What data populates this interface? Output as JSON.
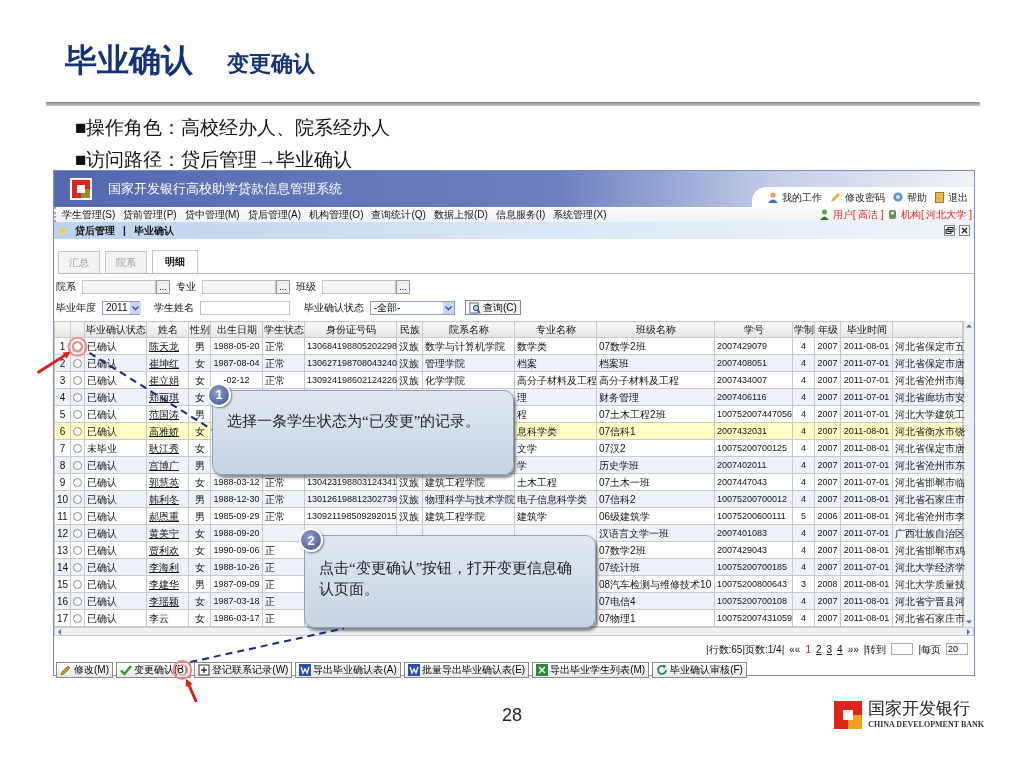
{
  "slide": {
    "title": "毕业确认",
    "subtitle": "变更确认",
    "bullets": [
      {
        "marker": "■",
        "text": "操作角色：高校经办人、院系经办人"
      },
      {
        "marker": "■",
        "text": "访问路径：贷后管理→毕业确认"
      }
    ],
    "page_number": "28",
    "footer_logo": {
      "name": "国家开发银行",
      "english": "CHINA DEVELOPMENT BANK"
    }
  },
  "app": {
    "title": "国家开发银行高校助学贷款信息管理系统",
    "top_links": [
      {
        "label": "我的工作",
        "kind": "user"
      },
      {
        "label": "修改密码",
        "kind": "pencil"
      },
      {
        "label": "帮助",
        "kind": "help"
      },
      {
        "label": "退出",
        "kind": "door"
      }
    ],
    "menu": [
      "学生管理(S)",
      "贷前管理(P)",
      "贷中管理(M)",
      "贷后管理(A)",
      "机构管理(O)",
      "查询统计(Q)",
      "数据上报(D)",
      "信息服务(I)",
      "系统管理(X)"
    ],
    "user": "用户[ 高洁 ]",
    "org": "机构[ 河北大学 ]",
    "breadcrumb": [
      "贷后管理",
      "|",
      "毕业确认"
    ],
    "tabs": [
      {
        "label": "汇总",
        "selected": false
      },
      {
        "label": "院系",
        "selected": false
      },
      {
        "label": "明细",
        "selected": true
      }
    ],
    "filters": [
      {
        "label": "院系",
        "button": "..."
      },
      {
        "label": "专业",
        "button": "..."
      },
      {
        "label": "班级",
        "button": "..."
      }
    ],
    "year": {
      "label": "毕业年度",
      "value": "2011"
    },
    "name_field": {
      "label": "学生姓名"
    },
    "status_filter": {
      "label": "毕业确认状态",
      "value": "-全部-"
    },
    "query_button": "查询(C)",
    "table": {
      "columns": [
        "毕业确认状态",
        "姓名",
        "性别",
        "出生日期",
        "学生状态",
        "身份证号码",
        "民族",
        "院系名称",
        "专业名称",
        "班级名称",
        "学号",
        "学制",
        "年级",
        "毕业时间"
      ],
      "rows": [
        {
          "number": "1",
          "selected": false,
          "highlighted": false,
          "linked": true,
          "cells": [
            "已确认",
            "陈天龙",
            "男",
            "1988-05-20",
            "正常",
            "130684198805202298",
            "汉族",
            "数学与计算机学院",
            "数学类",
            "07数学2班",
            "2007429079",
            "4",
            "2007",
            "2011-08-01",
            "河北省保定市五"
          ]
        },
        {
          "number": "2",
          "selected": false,
          "highlighted": false,
          "linked": true,
          "cells": [
            "已确认",
            "崔坤红",
            "女",
            "1987-08-04",
            "正常",
            "130627198708043240",
            "汉族",
            "管理学院",
            "档案",
            "档案班",
            "2007408051",
            "4",
            "2007",
            "2011-07-01",
            "河北省保定市唐"
          ]
        },
        {
          "number": "3",
          "selected": false,
          "highlighted": false,
          "linked": true,
          "cells": [
            "已确认",
            "崔立娟",
            "女",
            "-02-12",
            "正常",
            "130924198602124226",
            "汉族",
            "化学学院",
            "高分子材料及工程",
            "高分子材料及工程",
            "2007434007",
            "4",
            "2007",
            "2011-07-01",
            "河北省沧州市海"
          ]
        },
        {
          "number": "4",
          "selected": false,
          "highlighted": false,
          "linked": true,
          "cells": [
            "已确认",
            "郑丽琪",
            "女",
            null,
            null,
            null,
            null,
            null,
            "理",
            "财务管理",
            "2007406116",
            "4",
            "2007",
            "2011-07-01",
            "河北省廊坊市安"
          ]
        },
        {
          "number": "5",
          "selected": false,
          "highlighted": false,
          "linked": true,
          "cells": [
            "已确认",
            "范国涛",
            "男",
            null,
            null,
            null,
            null,
            null,
            "程",
            "07土木工程2班",
            "100752007447056",
            "4",
            "2007",
            "2011-07-01",
            "河北大学建筑工"
          ]
        },
        {
          "number": "6",
          "selected": false,
          "highlighted": true,
          "linked": true,
          "cells": [
            "已确认",
            "高雅娇",
            "女",
            null,
            null,
            null,
            null,
            null,
            "息科学类",
            "07信科1",
            "2007432031",
            "4",
            "2007",
            "2011-08-01",
            "河北省衡水市饶"
          ]
        },
        {
          "number": "7",
          "selected": false,
          "highlighted": false,
          "linked": true,
          "cells": [
            "未毕业",
            "耿江秀",
            "女",
            null,
            null,
            null,
            null,
            null,
            "文学",
            "07汉2",
            "10075200700125",
            "4",
            "2007",
            "2011-08-01",
            "河北省保定市唐"
          ]
        },
        {
          "number": "8",
          "selected": false,
          "highlighted": false,
          "linked": true,
          "cells": [
            "已确认",
            "宫博广",
            "男",
            null,
            null,
            null,
            null,
            null,
            "学",
            "历史学班",
            "2007402011",
            "4",
            "2007",
            "2011-07-01",
            "河北省沧州市东"
          ]
        },
        {
          "number": "9",
          "selected": false,
          "highlighted": false,
          "linked": true,
          "cells": [
            "已确认",
            "郭慧英",
            "女",
            "1988-03-12",
            "正常",
            "130423198803124341",
            "汉族",
            "建筑工程学院",
            "土木工程",
            "07土木一班",
            "2007447043",
            "4",
            "2007",
            "2011-07-01",
            "河北省邯郸市临"
          ]
        },
        {
          "number": "10",
          "selected": false,
          "highlighted": false,
          "linked": true,
          "cells": [
            "已确认",
            "韩利冬",
            "男",
            "1988-12-30",
            "正常",
            "130126198812302739",
            "汉族",
            "物理科学与技术学院",
            "电子信息科学类",
            "07信科2",
            "10075200700012",
            "4",
            "2007",
            "2011-08-01",
            "河北省石家庄市"
          ]
        },
        {
          "number": "11",
          "selected": false,
          "highlighted": false,
          "linked": true,
          "cells": [
            "已确认",
            "郝恩重",
            "男",
            "1985-09-29",
            "正常",
            "130921198509292015",
            "汉族",
            "建筑工程学院",
            "建筑学",
            "06级建筑学",
            "10075200600111",
            "5",
            "2006",
            "2011-08-01",
            "河北省沧州市李"
          ]
        },
        {
          "number": "12",
          "selected": false,
          "highlighted": false,
          "linked": true,
          "cells": [
            "已确认",
            "黄美宁",
            "女",
            "1988-09-20",
            null,
            null,
            null,
            null,
            null,
            "汉语言文学一班",
            "2007401083",
            "4",
            "2007",
            "2011-07-01",
            "广西壮族自治区"
          ]
        },
        {
          "number": "13",
          "selected": false,
          "highlighted": false,
          "linked": true,
          "cells": [
            "已确认",
            "贾利欢",
            "女",
            "1990-09-06",
            "正",
            null,
            null,
            null,
            null,
            "07数学2班",
            "2007429043",
            "4",
            "2007",
            "2011-08-01",
            "河北省邯郸市鸡"
          ]
        },
        {
          "number": "14",
          "selected": false,
          "highlighted": false,
          "linked": true,
          "cells": [
            "已确认",
            "李海利",
            "女",
            "1988-10-26",
            "正",
            null,
            null,
            null,
            null,
            "07统计班",
            "10075200700185",
            "4",
            "2007",
            "2011-07-01",
            "河北大学经济学"
          ]
        },
        {
          "number": "15",
          "selected": false,
          "highlighted": false,
          "linked": true,
          "cells": [
            "已确认",
            "李建华",
            "男",
            "1987-09-09",
            "正",
            null,
            null,
            null,
            null,
            "08汽车检测与维修技术10",
            "10075200800643",
            "3",
            "2008",
            "2011-08-01",
            "河北大学质量技"
          ]
        },
        {
          "number": "16",
          "selected": false,
          "highlighted": false,
          "linked": true,
          "cells": [
            "已确认",
            "李瑶颖",
            "女",
            "1987-03-18",
            "正",
            null,
            null,
            null,
            null,
            "07电信4",
            "10075200700108",
            "4",
            "2007",
            "2011-08-01",
            "河北省宁晋县河"
          ]
        },
        {
          "number": "17",
          "selected": false,
          "highlighted": false,
          "linked": false,
          "cells": [
            "已确认",
            "李云",
            "女",
            "1986-03-17",
            "正",
            null,
            null,
            null,
            null,
            "07物理1",
            "100752007431059",
            "4",
            "2007",
            "2011-08-01",
            "河北省石家庄市"
          ]
        }
      ]
    },
    "pager": {
      "summary": "|行数:65|页数:1/4|",
      "first": "««",
      "pages": [
        {
          "label": "1",
          "selected": true
        },
        {
          "label": "2",
          "selected": false
        },
        {
          "label": "3",
          "selected": false
        },
        {
          "label": "4",
          "selected": false
        }
      ],
      "last": "»»",
      "goto": "|转到",
      "per_page_label": "|每页",
      "per_page": "20"
    },
    "toolbar": [
      {
        "label": "修改(M)",
        "kind": "edit"
      },
      {
        "label": "变更确认(B)",
        "kind": "check"
      },
      {
        "label": "登记联系记录(W)",
        "kind": "add"
      },
      {
        "label": "导出毕业确认表(A)",
        "kind": "word"
      },
      {
        "label": "批量导出毕业确认表(E)",
        "kind": "word"
      },
      {
        "label": "导出毕业学生列表(M)",
        "kind": "excel"
      },
      {
        "label": "毕业确认审核(F)",
        "kind": "refresh"
      }
    ]
  },
  "callouts": [
    {
      "number": "1",
      "text": "选择一条学生状态为“已变更”的记录。"
    },
    {
      "number": "2",
      "text": "点击“变更确认”按钮，打开变更信息确认页面。"
    }
  ]
}
